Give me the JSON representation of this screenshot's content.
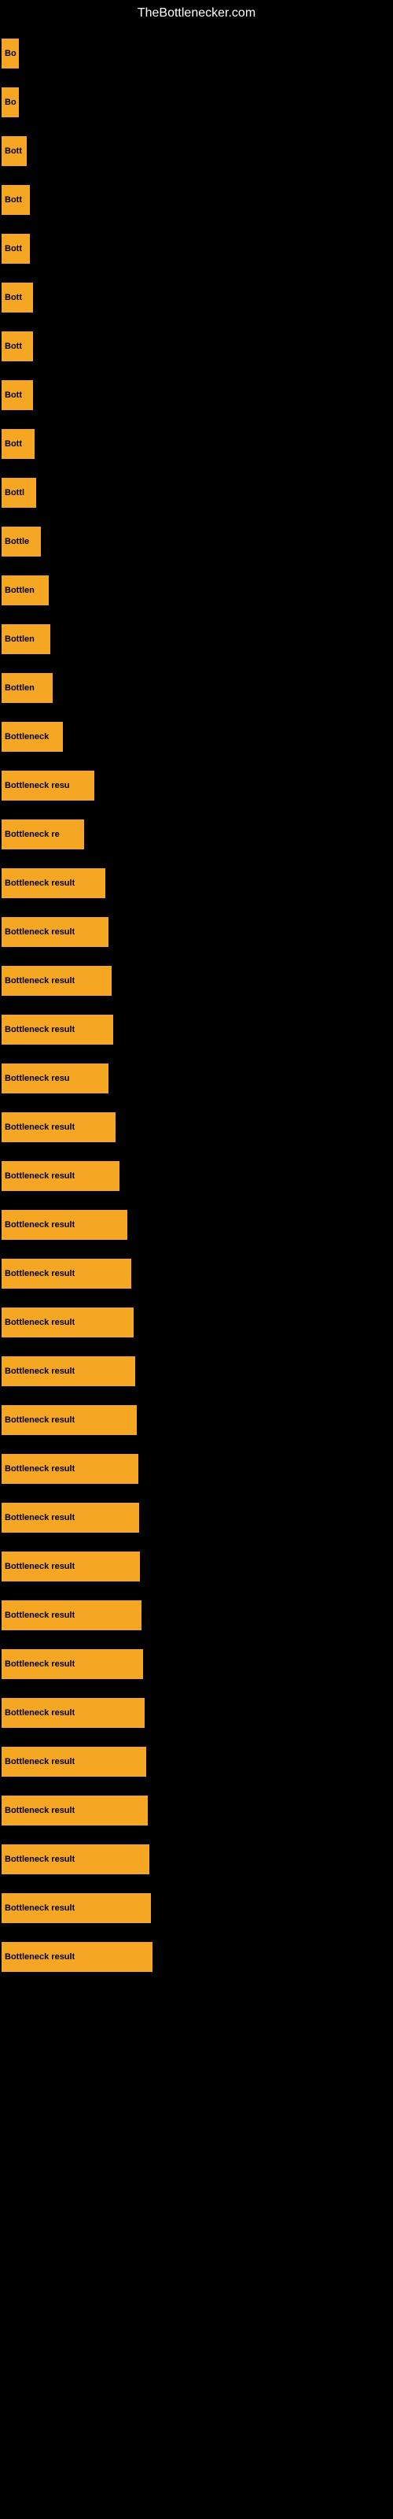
{
  "site": {
    "title": "TheBottlenecker.com"
  },
  "bars": [
    {
      "label": "Bo",
      "width": 22
    },
    {
      "label": "Bo",
      "width": 22
    },
    {
      "label": "Bott",
      "width": 32
    },
    {
      "label": "Bott",
      "width": 36
    },
    {
      "label": "Bott",
      "width": 36
    },
    {
      "label": "Bott",
      "width": 40
    },
    {
      "label": "Bott",
      "width": 40
    },
    {
      "label": "Bott",
      "width": 40
    },
    {
      "label": "Bott",
      "width": 42
    },
    {
      "label": "Bottl",
      "width": 44
    },
    {
      "label": "Bottle",
      "width": 50
    },
    {
      "label": "Bottlen",
      "width": 60
    },
    {
      "label": "Bottlen",
      "width": 62
    },
    {
      "label": "Bottlen",
      "width": 65
    },
    {
      "label": "Bottleneck",
      "width": 78
    },
    {
      "label": "Bottleneck resu",
      "width": 118
    },
    {
      "label": "Bottleneck re",
      "width": 105
    },
    {
      "label": "Bottleneck result",
      "width": 132
    },
    {
      "label": "Bottleneck result",
      "width": 136
    },
    {
      "label": "Bottleneck result",
      "width": 140
    },
    {
      "label": "Bottleneck result",
      "width": 142
    },
    {
      "label": "Bottleneck resu",
      "width": 136
    },
    {
      "label": "Bottleneck result",
      "width": 145
    },
    {
      "label": "Bottleneck result",
      "width": 150
    },
    {
      "label": "Bottleneck result",
      "width": 160
    },
    {
      "label": "Bottleneck result",
      "width": 165
    },
    {
      "label": "Bottleneck result",
      "width": 168
    },
    {
      "label": "Bottleneck result",
      "width": 170
    },
    {
      "label": "Bottleneck result",
      "width": 172
    },
    {
      "label": "Bottleneck result",
      "width": 174
    },
    {
      "label": "Bottleneck result",
      "width": 175
    },
    {
      "label": "Bottleneck result",
      "width": 176
    },
    {
      "label": "Bottleneck result",
      "width": 178
    },
    {
      "label": "Bottleneck result",
      "width": 180
    },
    {
      "label": "Bottleneck result",
      "width": 182
    },
    {
      "label": "Bottleneck result",
      "width": 184
    },
    {
      "label": "Bottleneck result",
      "width": 186
    },
    {
      "label": "Bottleneck result",
      "width": 188
    },
    {
      "label": "Bottleneck result",
      "width": 190
    },
    {
      "label": "Bottleneck result",
      "width": 192
    }
  ]
}
